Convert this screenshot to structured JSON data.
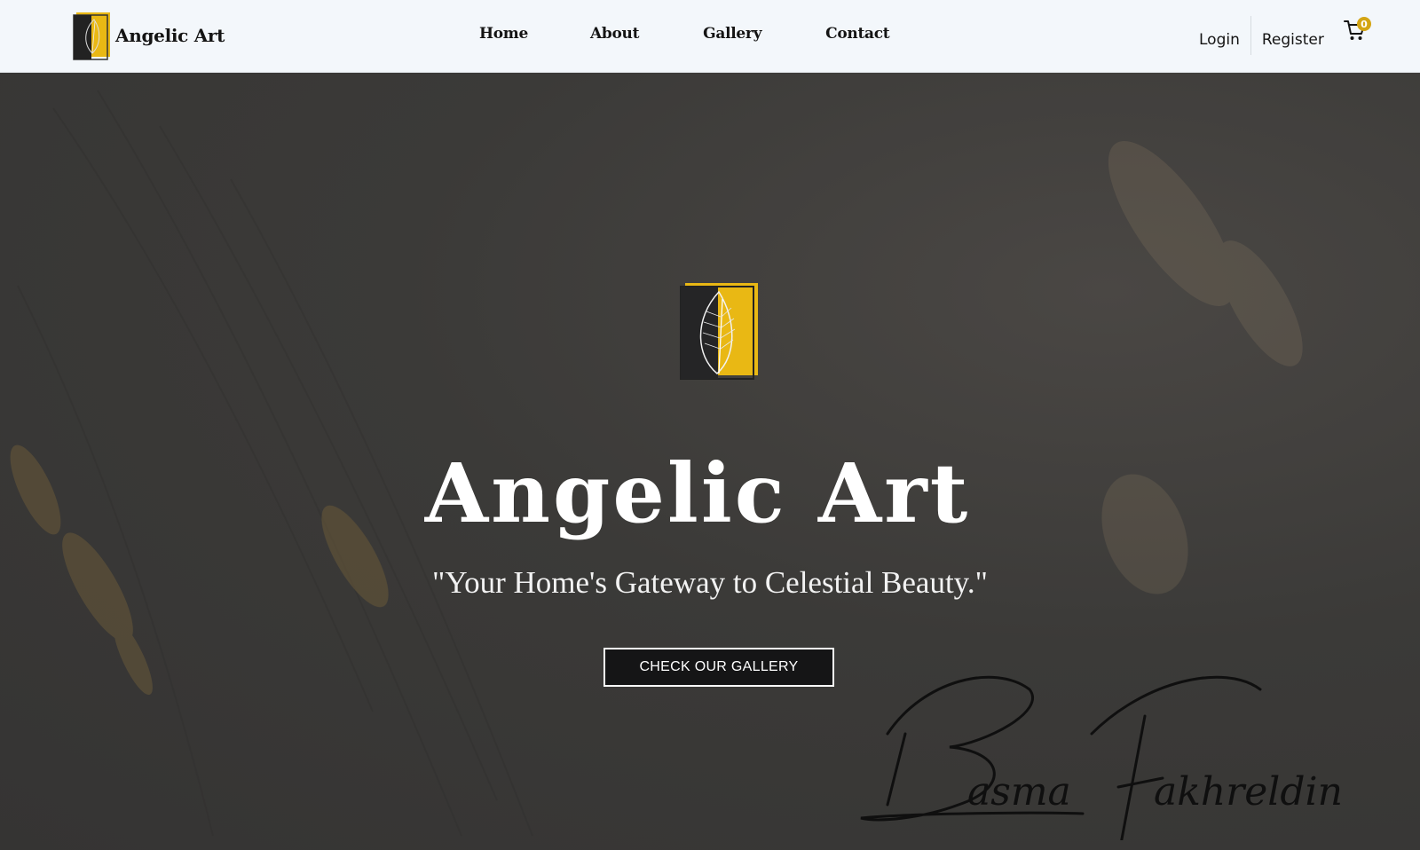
{
  "navbar": {
    "brand_name": "Angelic Art",
    "links": [
      "Home",
      "About",
      "Gallery",
      "Contact"
    ],
    "login": "Login",
    "register": "Register",
    "cart_count": "0"
  },
  "hero": {
    "title": "Angelic Art",
    "tagline": "\"Your Home's Gateway to Celestial Beauty.\"",
    "cta": "CHECK OUR GALLERY",
    "signature": "Basma Fakhreldin"
  },
  "colors": {
    "navbar_bg": "#f3f7fb",
    "accent_gold": "#d4a514",
    "hero_bg": "#3a3938",
    "button_bg": "#151516"
  },
  "icons": [
    "feather-logo-icon",
    "cart-icon"
  ]
}
